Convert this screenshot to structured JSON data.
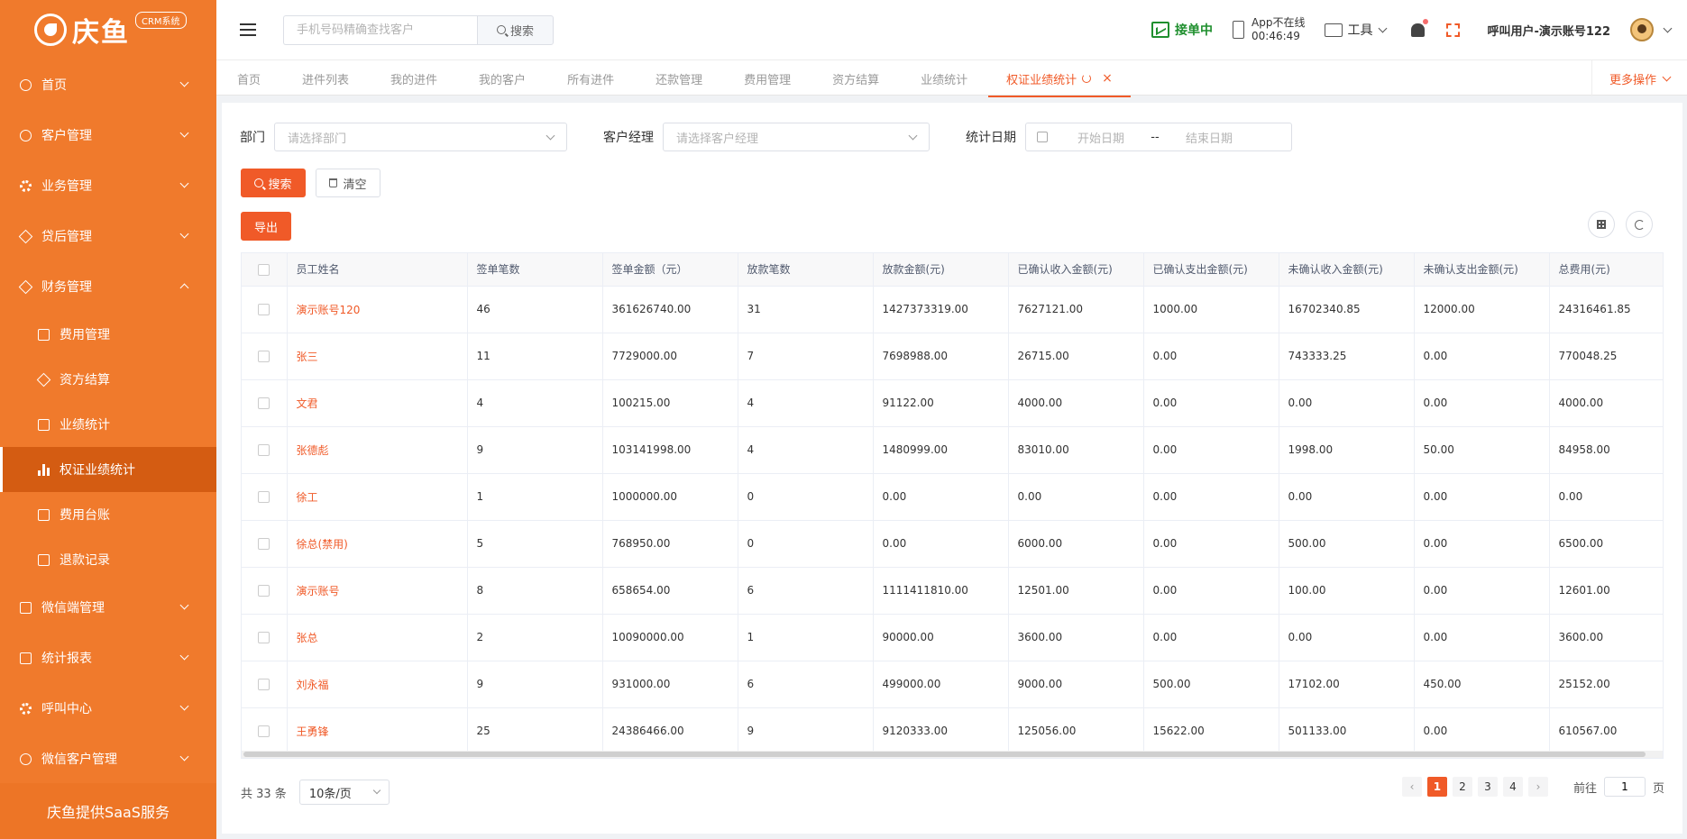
{
  "brand": {
    "name": "庆鱼",
    "badge": "CRM系统"
  },
  "sidebar": {
    "items": [
      {
        "label": "首页",
        "icon": "user-icon",
        "expanded": false
      },
      {
        "label": "客户管理",
        "icon": "customer-icon",
        "expanded": false
      },
      {
        "label": "业务管理",
        "icon": "gear-icon",
        "expanded": false
      },
      {
        "label": "贷后管理",
        "icon": "tag-icon",
        "expanded": false
      },
      {
        "label": "财务管理",
        "icon": "tag-icon",
        "expanded": true
      },
      {
        "label": "微信端管理",
        "icon": "edit-icon",
        "expanded": false
      },
      {
        "label": "统计报表",
        "icon": "table-icon",
        "expanded": false
      },
      {
        "label": "呼叫中心",
        "icon": "gear-icon",
        "expanded": false
      },
      {
        "label": "微信客户管理",
        "icon": "customer-icon",
        "expanded": false
      }
    ],
    "finance_sub": [
      {
        "label": "费用管理",
        "icon": "checkbox-icon"
      },
      {
        "label": "资方结算",
        "icon": "tag-icon"
      },
      {
        "label": "业绩统计",
        "icon": "checkbox-icon"
      },
      {
        "label": "权证业绩统计",
        "icon": "bar-chart-icon",
        "active": true
      },
      {
        "label": "费用台账",
        "icon": "book-icon"
      },
      {
        "label": "退款记录",
        "icon": "list-icon"
      }
    ],
    "footer": "庆鱼提供SaaS服务"
  },
  "header": {
    "search_placeholder": "手机号码精确查找客户",
    "search_button": "搜索",
    "accept_status": "接单中",
    "app_status_line1": "App不在线",
    "app_status_line2": "00:46:49",
    "tools_label": "工具",
    "user_label": "呼叫用户-演示账号122"
  },
  "tabs": {
    "items": [
      "首页",
      "进件列表",
      "我的进件",
      "我的客户",
      "所有进件",
      "还款管理",
      "费用管理",
      "资方结算",
      "业绩统计"
    ],
    "active": "权证业绩统计",
    "more": "更多操作"
  },
  "filters": {
    "dept_label": "部门",
    "dept_placeholder": "请选择部门",
    "manager_label": "客户经理",
    "manager_placeholder": "请选择客户经理",
    "date_label": "统计日期",
    "start_placeholder": "开始日期",
    "date_sep": "--",
    "end_placeholder": "结束日期",
    "search_button": "搜索",
    "clear_button": "清空",
    "export_button": "导出"
  },
  "table": {
    "columns": [
      "员工姓名",
      "签单笔数",
      "签单金额（元）",
      "放款笔数",
      "放款金额(元)",
      "已确认收入金额(元)",
      "已确认支出金额(元)",
      "未确认收入金额(元)",
      "未确认支出金额(元)",
      "总费用(元)"
    ],
    "rows": [
      [
        "演示账号120",
        "46",
        "361626740.00",
        "31",
        "1427373319.00",
        "7627121.00",
        "1000.00",
        "16702340.85",
        "12000.00",
        "24316461.85"
      ],
      [
        "张三",
        "11",
        "7729000.00",
        "7",
        "7698988.00",
        "26715.00",
        "0.00",
        "743333.25",
        "0.00",
        "770048.25"
      ],
      [
        "文君",
        "4",
        "100215.00",
        "4",
        "91122.00",
        "4000.00",
        "0.00",
        "0.00",
        "0.00",
        "4000.00"
      ],
      [
        "张德彪",
        "9",
        "103141998.00",
        "4",
        "1480999.00",
        "83010.00",
        "0.00",
        "1998.00",
        "50.00",
        "84958.00"
      ],
      [
        "徐工",
        "1",
        "1000000.00",
        "0",
        "0.00",
        "0.00",
        "0.00",
        "0.00",
        "0.00",
        "0.00"
      ],
      [
        "徐总(禁用)",
        "5",
        "768950.00",
        "0",
        "0.00",
        "6000.00",
        "0.00",
        "500.00",
        "0.00",
        "6500.00"
      ],
      [
        "演示账号",
        "8",
        "658654.00",
        "6",
        "1111411810.00",
        "12501.00",
        "0.00",
        "100.00",
        "0.00",
        "12601.00"
      ],
      [
        "张总",
        "2",
        "10090000.00",
        "1",
        "90000.00",
        "3600.00",
        "0.00",
        "0.00",
        "0.00",
        "3600.00"
      ],
      [
        "刘永福",
        "9",
        "931000.00",
        "6",
        "499000.00",
        "9000.00",
        "500.00",
        "17102.00",
        "450.00",
        "25152.00"
      ],
      [
        "王勇锋",
        "25",
        "24386466.00",
        "9",
        "9120333.00",
        "125056.00",
        "15622.00",
        "501133.00",
        "0.00",
        "610567.00"
      ]
    ]
  },
  "pagination": {
    "total_text": "共 33 条",
    "page_size": "10条/页",
    "pages": [
      "1",
      "2",
      "3",
      "4"
    ],
    "current": "1",
    "goto_label": "前往",
    "goto_value": "1",
    "page_suffix": "页"
  },
  "colors": {
    "sidebar": "#f07a2c",
    "accent": "#f05a28",
    "accept_green": "#1f8f2e"
  }
}
